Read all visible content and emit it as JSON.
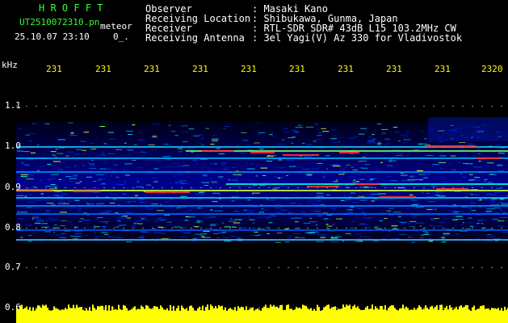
{
  "header": {
    "app_title": "H R O F F T",
    "filename": "UT2510072310.pn",
    "meteor_label": "meteor",
    "datetime": "25.10.07 23:10",
    "counter": "0_.",
    "rows": [
      {
        "label": "Observer",
        "value": ": Masaki Kano"
      },
      {
        "label": "Receiving Location",
        "value": ": Shibukawa, Gunma, Japan"
      },
      {
        "label": "Receiver",
        "value": ": RTL-SDR SDR# 43dB L15 103.2MHz CW"
      },
      {
        "label": "Receiving Antenna",
        "value": ": 3el Yagi(V) Az 330 for Vladivostok"
      }
    ]
  },
  "axes": {
    "y_unit": "kHz",
    "y_ticks": [
      "1.1",
      "1.0",
      "0.9",
      "0.8",
      "0.7",
      "0.6"
    ],
    "x_ticks": [
      "231",
      "231",
      "231",
      "231",
      "231",
      "231",
      "231",
      "231",
      "231",
      "2320"
    ]
  },
  "colors": {
    "title_green": "#33ff33",
    "tick_yellow": "#ffff00",
    "noise_yellow": "#ffff00",
    "band_blue": "#0000ff",
    "peak_red": "#ff3030"
  }
}
